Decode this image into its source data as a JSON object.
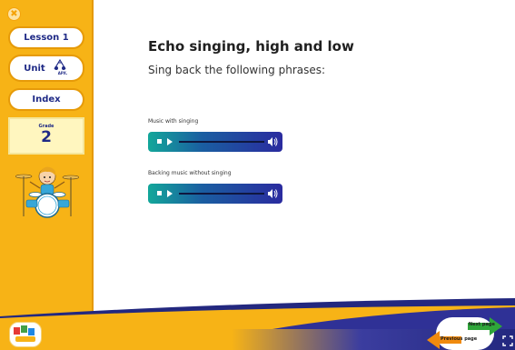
{
  "sidebar": {
    "close_symbol": "✖",
    "lesson_label": "Lesson 1",
    "unit_label": "Unit",
    "unit_badge_text": "ΑΡΧ.",
    "index_label": "Index",
    "grade_label": "Grade",
    "grade_value": "2"
  },
  "main": {
    "title": "Echo singing, high and low",
    "subtitle": "Sing back the following phrases:",
    "audio_tracks": [
      {
        "label": "Music with singing"
      },
      {
        "label": "Backing music without singing"
      }
    ]
  },
  "footer": {
    "next_label": "Next page",
    "prev_label": "Previous page"
  },
  "colors": {
    "sidebar": "#f7b316",
    "text_dark": "#1f2a86",
    "player_start": "#13a79a",
    "player_end": "#2a2b9f",
    "next_arrow": "#2fa63a",
    "prev_arrow": "#f08a0e"
  },
  "icons": {
    "close": "close-icon",
    "unit": "music-note-badge-icon",
    "drummer": "drummer-illustration",
    "play": "play-icon",
    "stop": "stop-icon",
    "volume": "volume-icon",
    "next": "arrow-right-icon",
    "prev": "arrow-left-icon",
    "expand": "fullscreen-icon"
  }
}
